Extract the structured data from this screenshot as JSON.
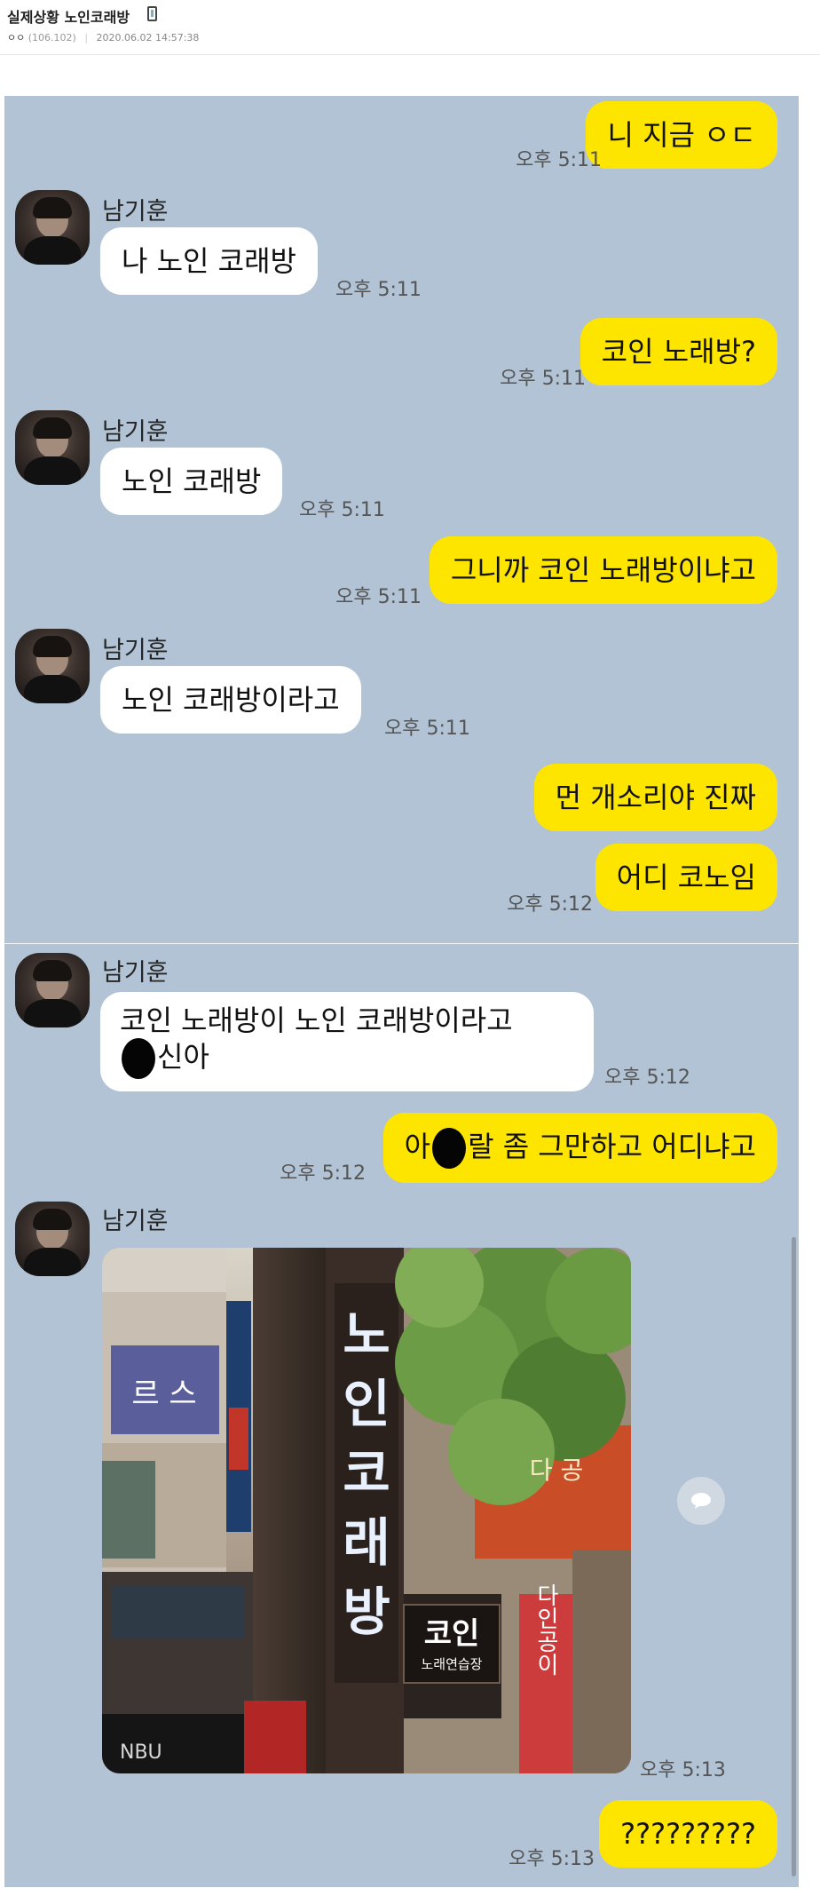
{
  "post": {
    "title": "실제상황 노인코래방",
    "author": "ㅇㅇ",
    "ip": "(106.102)",
    "datetime": "2020.06.02 14:57:38"
  },
  "chat": {
    "contact_name": "남기훈",
    "messages_top": [
      {
        "side": "out",
        "text": "니 지금 ㅇㄷ",
        "time": "오후 5:11"
      },
      {
        "side": "in",
        "text": "나 노인 코래방",
        "time": "오후 5:11"
      },
      {
        "side": "out",
        "text": "코인 노래방?",
        "time": "오후 5:11"
      },
      {
        "side": "in",
        "text": "노인 코래방",
        "time": "오후 5:11"
      },
      {
        "side": "out",
        "text": "그니까 코인 노래방이냐고",
        "time": "오후 5:11"
      },
      {
        "side": "in",
        "text": "노인 코래방이라고",
        "time": "오후 5:11"
      },
      {
        "side": "out",
        "text": "먼 개소리야 진짜",
        "time": ""
      },
      {
        "side": "out",
        "text": "어디 코노임",
        "time": "오후 5:12"
      }
    ],
    "messages_bottom": [
      {
        "side": "in",
        "line1": "코인 노래방이 노인 코래방이라고",
        "line2": "신아",
        "time": "오후 5:12"
      },
      {
        "side": "out",
        "pre": "아",
        "post": "랄 좀 그만하고 어디냐고",
        "time": "오후 5:12"
      },
      {
        "side": "in",
        "type": "photo",
        "time": "오후 5:13"
      },
      {
        "side": "out",
        "text": "?????????",
        "time": "오후 5:13"
      }
    ],
    "photo": {
      "vertical_sign": "노인코래방",
      "coin_sign": "코인",
      "coin_sign_sub": "노래연습장",
      "side_sign_left": "르 스",
      "right_sign": "다인공이",
      "right_top_sign": "다 공",
      "bottom_left_sign": "NBU"
    }
  },
  "colors": {
    "chat_bg": "#b1c3d5",
    "out_bubble": "#fee500",
    "in_bubble": "#ffffff"
  }
}
